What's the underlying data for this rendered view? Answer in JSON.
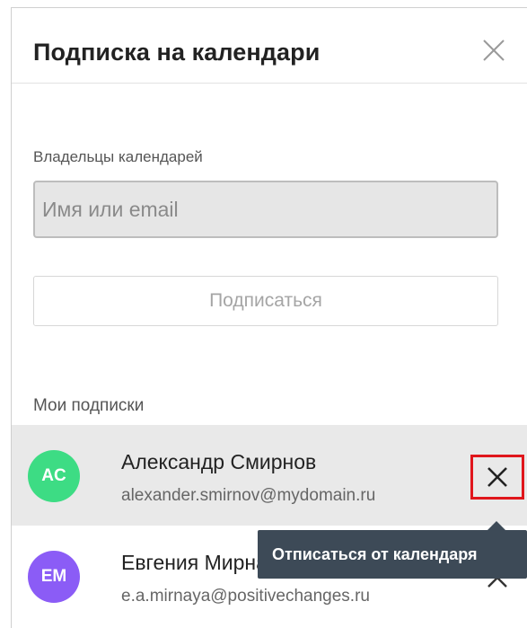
{
  "dialog": {
    "title": "Подписка на календари",
    "close_icon": "close-icon"
  },
  "owners": {
    "label": "Владельцы календарей",
    "input_placeholder": "Имя или email",
    "input_value": "",
    "subscribe_label": "Подписаться"
  },
  "subscriptions": {
    "label": "Мои подписки",
    "items": [
      {
        "initials": "AC",
        "name": "Александр Смирнов",
        "email": "alexander.smirnov@mydomain.ru",
        "avatar_color": "#3ddc84",
        "remove_icon": "close-icon"
      },
      {
        "initials": "EM",
        "name": "Евгения Мирная",
        "email": "e.a.mirnaya@positivechanges.ru",
        "avatar_color": "#8b5cf6",
        "remove_icon": "close-icon"
      }
    ]
  },
  "tooltip": {
    "text": "Отписаться от календаря"
  },
  "colors": {
    "highlight_border": "#e0161c",
    "tooltip_bg": "#3d4a57",
    "hover_row_bg": "#e9e9e9"
  }
}
